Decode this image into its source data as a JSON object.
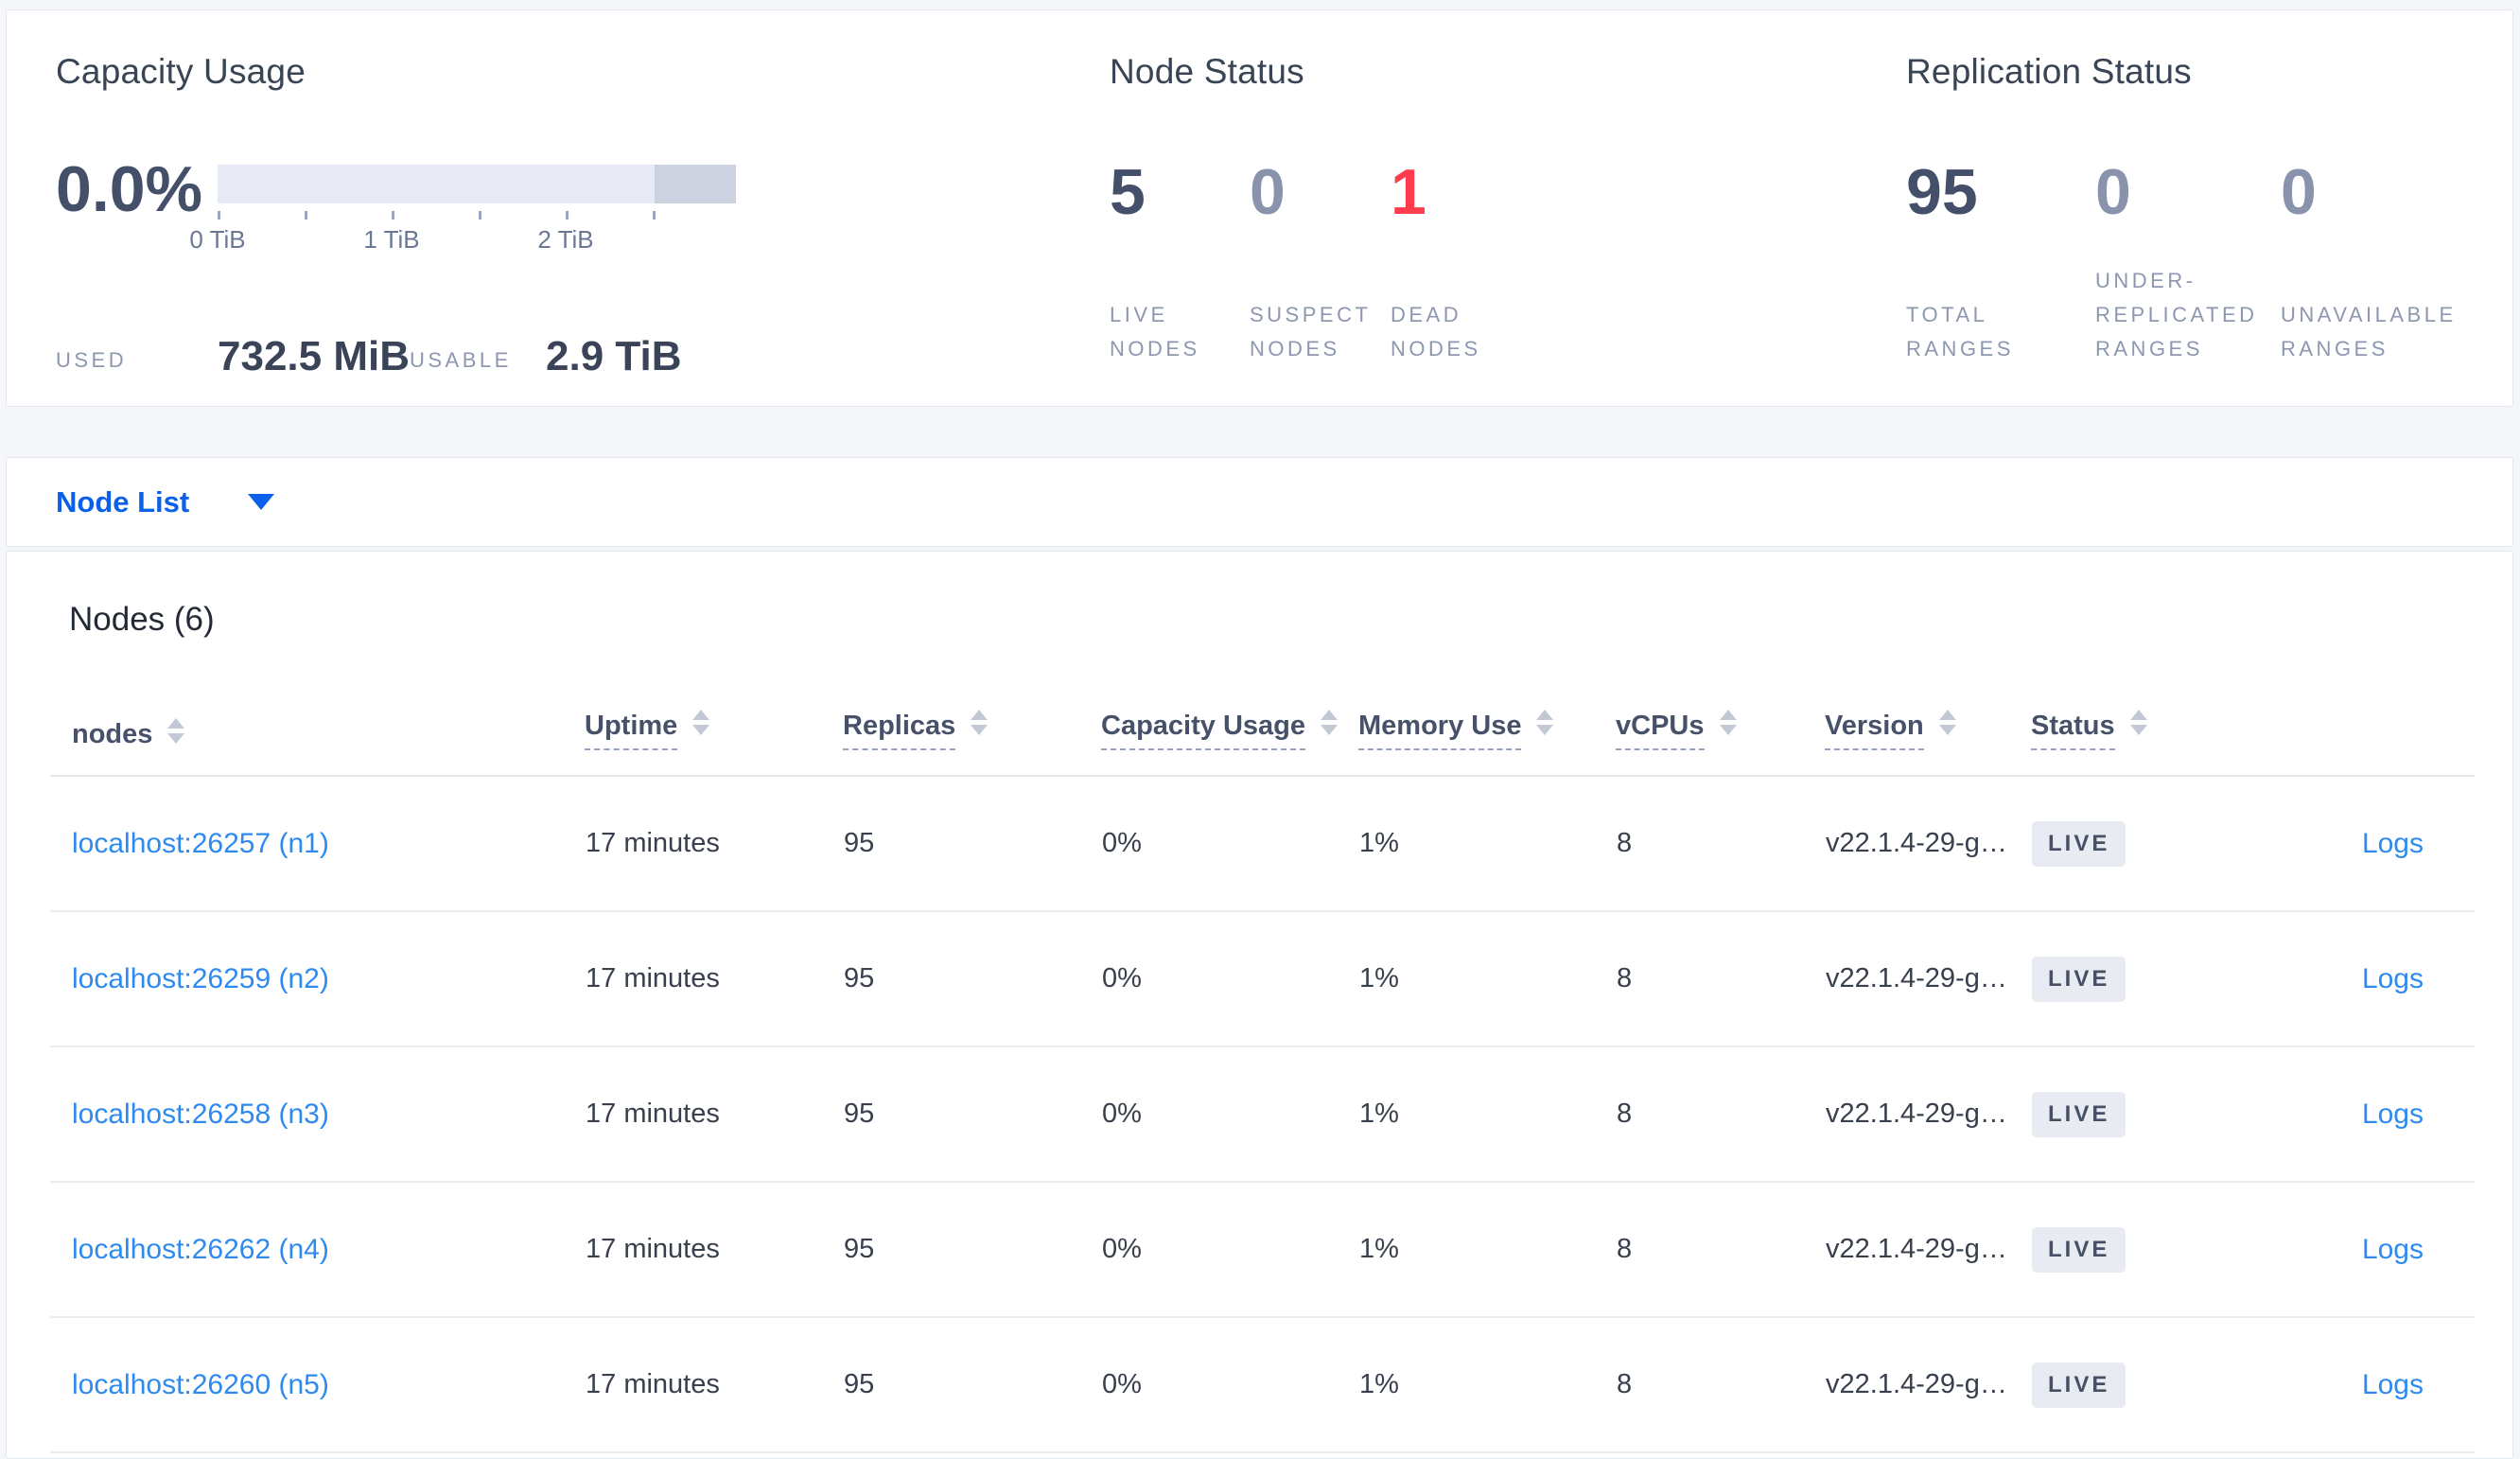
{
  "overview": {
    "capacity": {
      "title": "Capacity Usage",
      "percent": "0.0%",
      "used_label": "USED",
      "used_value": "732.5 MiB",
      "usable_label": "USABLE",
      "usable_value": "2.9 TiB",
      "tick_labels": [
        "0 TiB",
        "",
        "1 TiB",
        "",
        "2 TiB",
        ""
      ],
      "bar_light_color": "#e7e9f4",
      "bar_dark_color": "#ccd2df"
    },
    "node_status": {
      "title": "Node Status",
      "stats": [
        {
          "value": "5",
          "label": "LIVE NODES",
          "tone": "dark"
        },
        {
          "value": "0",
          "label": "SUSPECT NODES",
          "tone": "muted"
        },
        {
          "value": "1",
          "label": "DEAD NODES",
          "tone": "red"
        }
      ]
    },
    "replication": {
      "title": "Replication Status",
      "stats": [
        {
          "value": "95",
          "label": "TOTAL RANGES",
          "tone": "dark"
        },
        {
          "value": "0",
          "label": "UNDER-REPLICATED RANGES",
          "tone": "muted"
        },
        {
          "value": "0",
          "label": "UNAVAILABLE RANGES",
          "tone": "muted"
        }
      ]
    },
    "accent_colors": {
      "dark": "#44506a",
      "muted": "#8a93ac",
      "red": "#fd3d4e"
    }
  },
  "node_list": {
    "selector_label": "Node List",
    "heading": "Nodes (6)"
  },
  "table": {
    "columns": [
      {
        "label": "nodes",
        "key": "address",
        "underlined": false,
        "sortable": true
      },
      {
        "label": "Uptime",
        "key": "uptime",
        "underlined": true,
        "sortable": true
      },
      {
        "label": "Replicas",
        "key": "replicas",
        "underlined": true,
        "sortable": true
      },
      {
        "label": "Capacity Usage",
        "key": "capacity",
        "underlined": true,
        "sortable": true
      },
      {
        "label": "Memory Use",
        "key": "memory",
        "underlined": true,
        "sortable": true
      },
      {
        "label": "vCPUs",
        "key": "vcpus",
        "underlined": true,
        "sortable": true
      },
      {
        "label": "Version",
        "key": "version",
        "underlined": true,
        "sortable": true
      },
      {
        "label": "Status",
        "key": "status",
        "underlined": true,
        "sortable": true
      },
      {
        "label": "",
        "key": "logs",
        "underlined": false,
        "sortable": false
      }
    ],
    "rows": [
      {
        "address": "localhost:26257 (n1)",
        "uptime": "17 minutes",
        "replicas": "95",
        "capacity": "0%",
        "memory": "1%",
        "vcpus": "8",
        "version": "v22.1.4-29-g…",
        "status": "LIVE",
        "logs": "Logs"
      },
      {
        "address": "localhost:26259 (n2)",
        "uptime": "17 minutes",
        "replicas": "95",
        "capacity": "0%",
        "memory": "1%",
        "vcpus": "8",
        "version": "v22.1.4-29-g…",
        "status": "LIVE",
        "logs": "Logs"
      },
      {
        "address": "localhost:26258 (n3)",
        "uptime": "17 minutes",
        "replicas": "95",
        "capacity": "0%",
        "memory": "1%",
        "vcpus": "8",
        "version": "v22.1.4-29-g…",
        "status": "LIVE",
        "logs": "Logs"
      },
      {
        "address": "localhost:26262 (n4)",
        "uptime": "17 minutes",
        "replicas": "95",
        "capacity": "0%",
        "memory": "1%",
        "vcpus": "8",
        "version": "v22.1.4-29-g…",
        "status": "LIVE",
        "logs": "Logs"
      },
      {
        "address": "localhost:26260 (n5)",
        "uptime": "17 minutes",
        "replicas": "95",
        "capacity": "0%",
        "memory": "1%",
        "vcpus": "8",
        "version": "v22.1.4-29-g…",
        "status": "LIVE",
        "logs": "Logs"
      }
    ]
  }
}
